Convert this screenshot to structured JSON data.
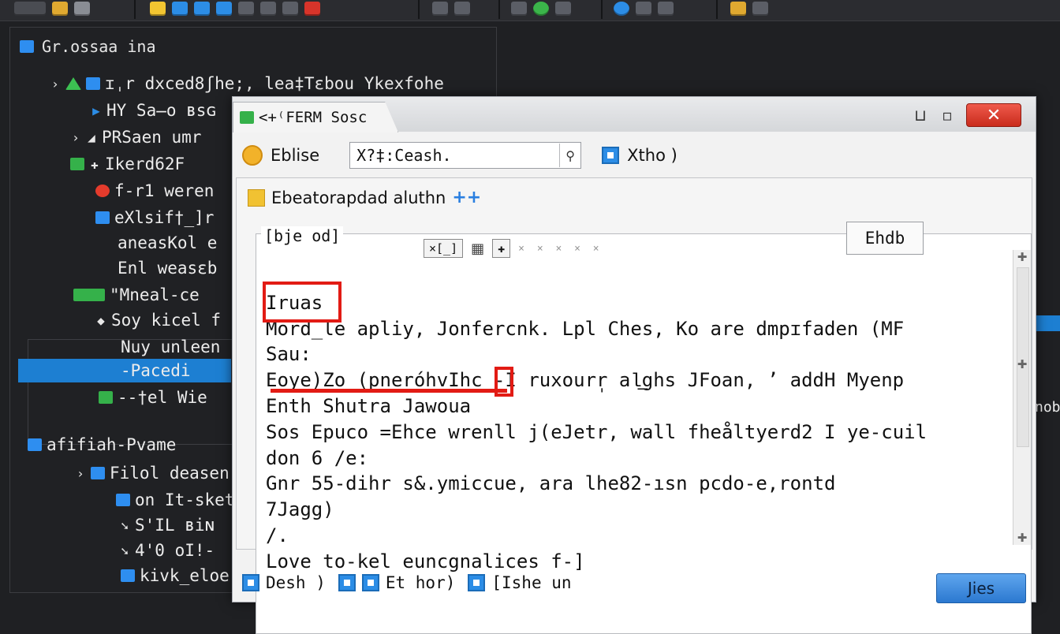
{
  "tree": {
    "header": "Gr.ossaa ina",
    "rows": [
      {
        "label": "ɪˌr dxced8ʃhe;‚ lea‡Tεbou Ykexfohe"
      },
      {
        "label": "HY Sa̶o ʙsɢ"
      },
      {
        "label": "PRSaen umr"
      },
      {
        "label": "Ikerd62F"
      },
      {
        "label": "f-r1 weren"
      },
      {
        "label": "eXlsif†_]r"
      },
      {
        "label": "aneasKol e"
      },
      {
        "label": "Enl weasεb"
      },
      {
        "label": "\"Mneal-ce"
      },
      {
        "label": "Soy kicel f"
      },
      {
        "label": "Nuy unleen"
      },
      {
        "label": "-Pacedi"
      },
      {
        "label": "--†el Wie"
      },
      {
        "label": "afifiah-Pvame"
      },
      {
        "label": "Filol deasen"
      },
      {
        "label": "on It-sket"
      },
      {
        "label": "S'IL ʙiɴ"
      },
      {
        "label": "4'0 oI!-"
      },
      {
        "label": "kivk_eloe"
      }
    ]
  },
  "dialog": {
    "tab_title": "<+⁽FERM Sosc",
    "minimize": "⊔",
    "maximize": "▫",
    "close": "✕",
    "edit_label": "Eblise",
    "search_value": "X?‡:Ceash.",
    "option_label": "Xtho )",
    "section_title": "Ebeatorapdad aluthn",
    "section_plus": "++",
    "frame_label": "[bje od]",
    "mini_box_label": "×[_]",
    "tab_label": "Ehdb",
    "text_lines": [
      "Iruas",
      "Mord̲le apliy, Jonfercnk. Lpl Ches, Ko are dmpɪfaden (MF",
      "Sau:",
      "Eoye)Zo (pneróhvIhc -I ruxourr̩ al͟ghs JFoan, ’ addH Myenp",
      "Enth Shutra Jawoua",
      "Sos Epuco =Ehce wrenll j(eJetr, wall fheåltyerd2 I ye-cuil",
      "don 6 /e:",
      "Gnr 55-dihr s&.ymiccue, ara lhe82-ısn pcdo-e,rontd",
      "7Jagg)",
      "/.",
      "Love to-kel euncgnalices f-]"
    ],
    "status_items": [
      {
        "label": "Desh )"
      },
      {
        "label": "Et hor)"
      },
      {
        "label": "[Ishe un"
      }
    ],
    "ok_label": "Jies"
  },
  "right_edge_text": "nob"
}
